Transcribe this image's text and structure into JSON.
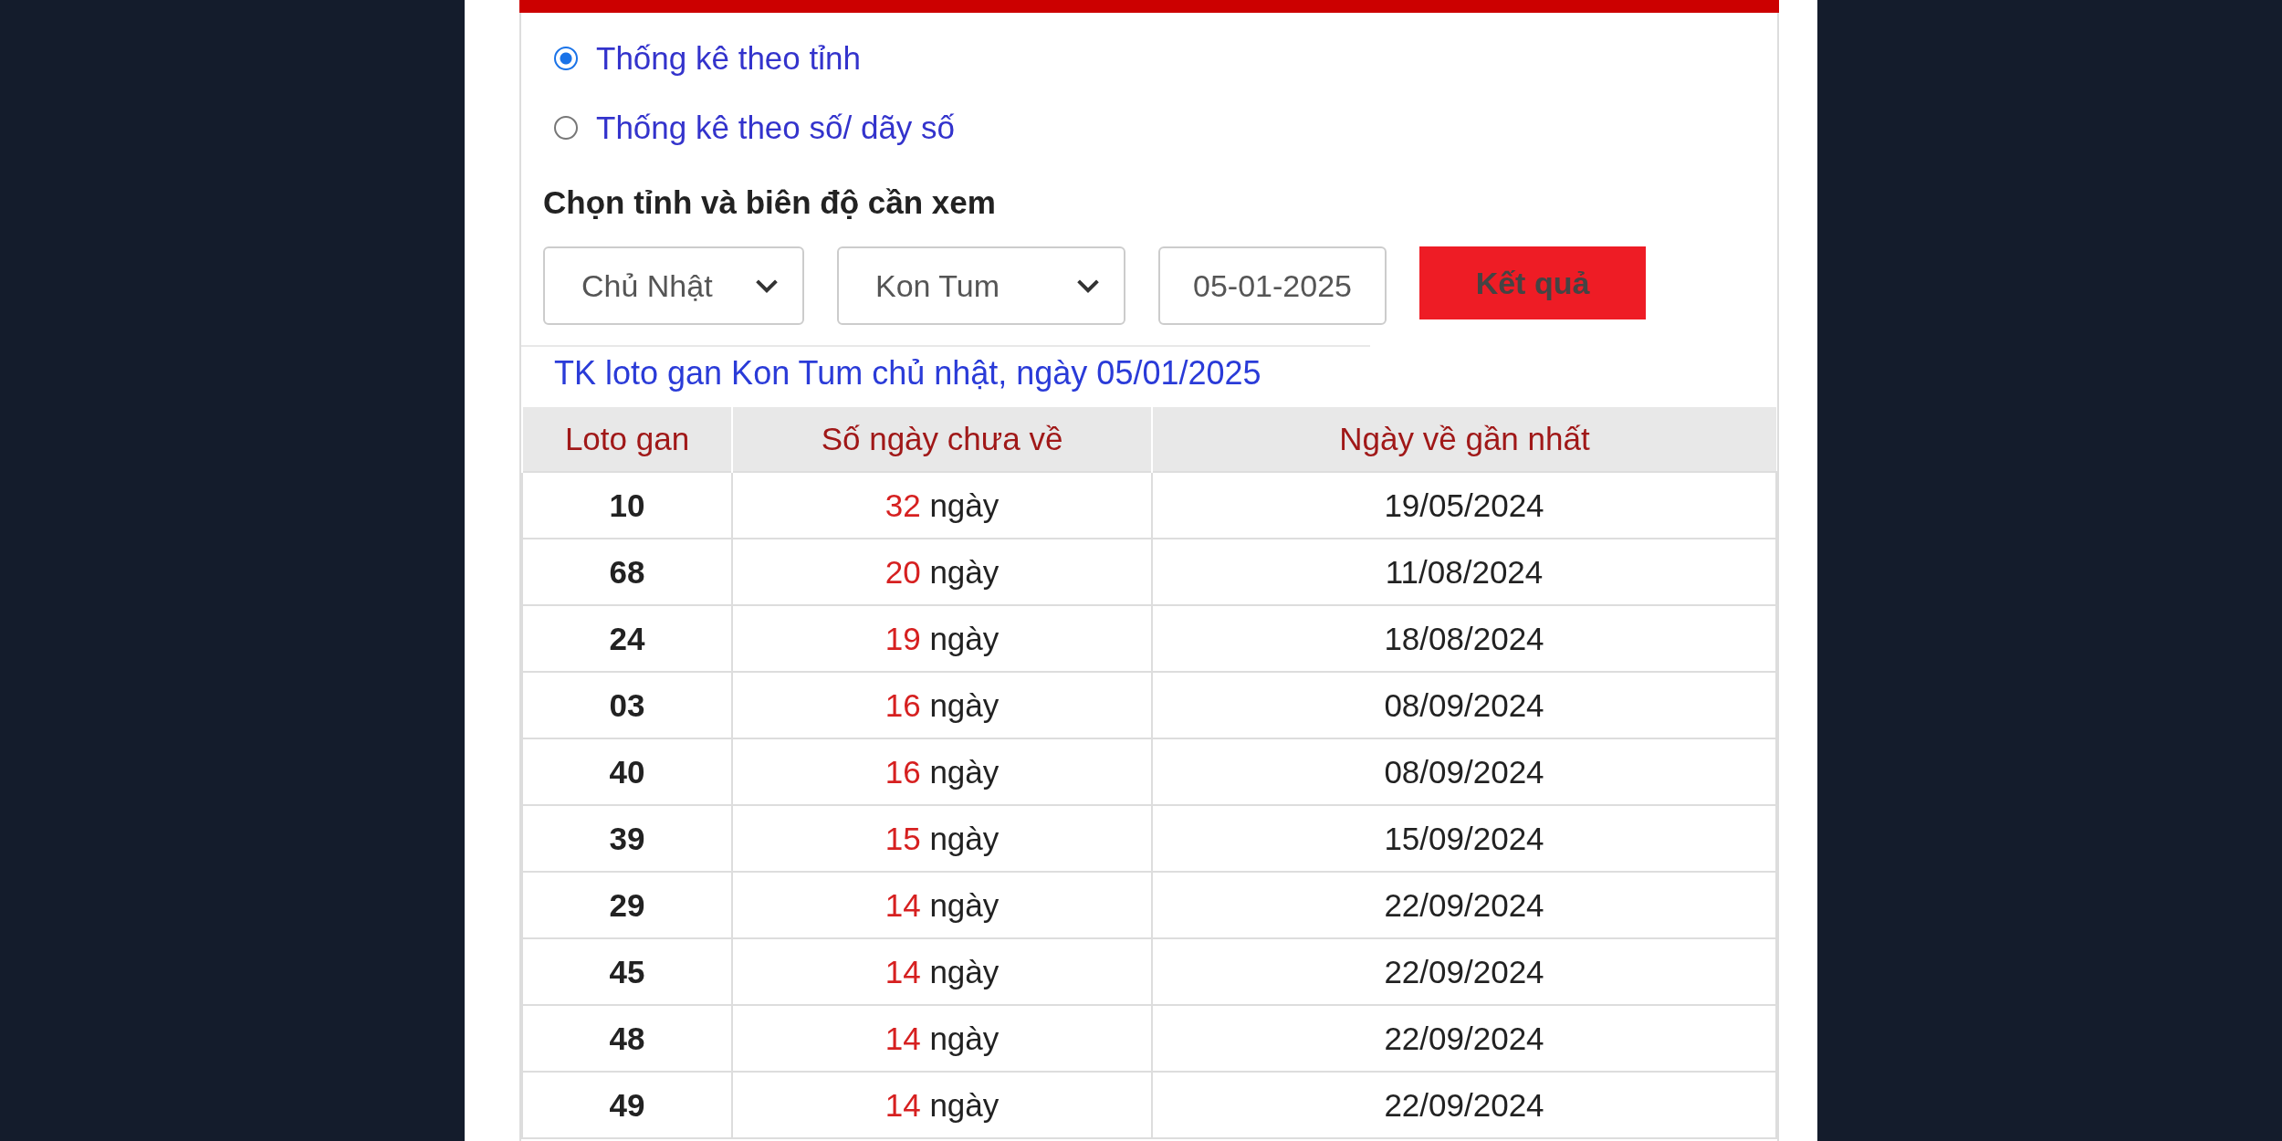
{
  "mode_options": [
    {
      "label": "Thống kê theo tỉnh",
      "selected": true
    },
    {
      "label": "Thống kê theo số/ dãy số",
      "selected": false
    }
  ],
  "form": {
    "heading": "Chọn tỉnh và biên độ cần xem",
    "day_select": "Chủ Nhật",
    "province_select": "Kon Tum",
    "date": "05-01-2025",
    "submit": "Kết quả"
  },
  "result_title": "TK loto gan Kon Tum chủ nhật, ngày 05/01/2025",
  "table": {
    "columns": [
      "Loto gan",
      "Số ngày chưa về",
      "Ngày về gần nhất"
    ],
    "rows": [
      {
        "loto": "10",
        "days": "32",
        "unit": "ngày",
        "last_date": "19/05/2024"
      },
      {
        "loto": "68",
        "days": "20",
        "unit": "ngày",
        "last_date": "11/08/2024"
      },
      {
        "loto": "24",
        "days": "19",
        "unit": "ngày",
        "last_date": "18/08/2024"
      },
      {
        "loto": "03",
        "days": "16",
        "unit": "ngày",
        "last_date": "08/09/2024"
      },
      {
        "loto": "40",
        "days": "16",
        "unit": "ngày",
        "last_date": "08/09/2024"
      },
      {
        "loto": "39",
        "days": "15",
        "unit": "ngày",
        "last_date": "15/09/2024"
      },
      {
        "loto": "29",
        "days": "14",
        "unit": "ngày",
        "last_date": "22/09/2024"
      },
      {
        "loto": "45",
        "days": "14",
        "unit": "ngày",
        "last_date": "22/09/2024"
      },
      {
        "loto": "48",
        "days": "14",
        "unit": "ngày",
        "last_date": "22/09/2024"
      },
      {
        "loto": "49",
        "days": "14",
        "unit": "ngày",
        "last_date": "22/09/2024"
      }
    ]
  }
}
